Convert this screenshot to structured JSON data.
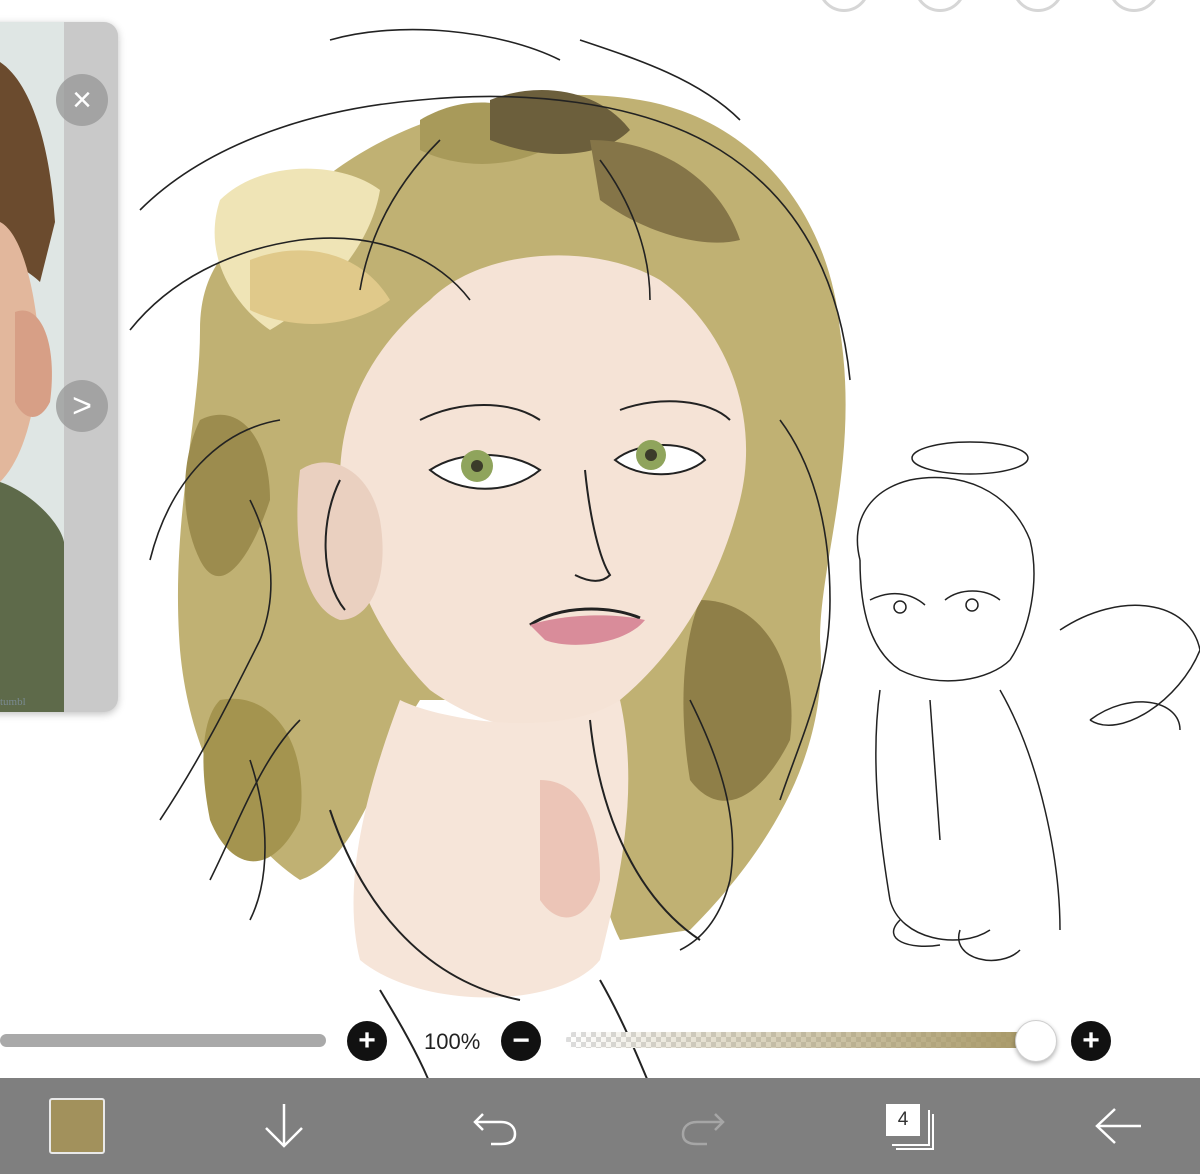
{
  "reference_panel": {
    "close_glyph": "×",
    "next_glyph": ">",
    "watermark": "tumbl"
  },
  "slider_row": {
    "opacity_label": "100%",
    "opacity_value_percent": 100,
    "plus_glyph": "+",
    "minus_glyph": "−"
  },
  "toolbar": {
    "current_color": "#a2915c",
    "layer_count": "4",
    "icons": [
      "down-arrow-icon",
      "undo-icon",
      "redo-icon",
      "layers-icon",
      "back-arrow-icon"
    ]
  },
  "colors": {
    "toolbar_bg": "#7f7f7f",
    "hair_light": "#d8c98a",
    "hair_mid": "#b2a25e",
    "hair_dark": "#6f6440",
    "skin": "#f4e2d6",
    "eye": "#8aa05a",
    "lips": "#d48a98"
  }
}
